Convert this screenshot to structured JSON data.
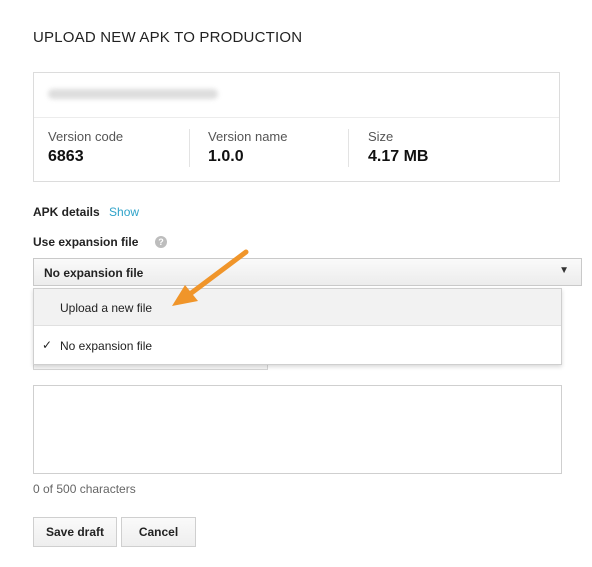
{
  "dialog": {
    "title": "UPLOAD NEW APK TO PRODUCTION"
  },
  "apk": {
    "stats": [
      {
        "label": "Version code",
        "value": "6863"
      },
      {
        "label": "Version name",
        "value": "1.0.0"
      },
      {
        "label": "Size",
        "value": "4.17 MB"
      }
    ]
  },
  "details": {
    "label": "APK details",
    "link": "Show"
  },
  "expansion": {
    "label": "Use expansion file",
    "help_icon": "question-mark",
    "selected": "No expansion file",
    "options": [
      "Upload a new file",
      "No expansion file"
    ]
  },
  "notes": {
    "char_count": "0 of 500 characters"
  },
  "buttons": {
    "save": "Save draft",
    "cancel": "Cancel"
  },
  "colors": {
    "link": "#2fa3c9",
    "annotation_arrow": "#f0952a"
  }
}
